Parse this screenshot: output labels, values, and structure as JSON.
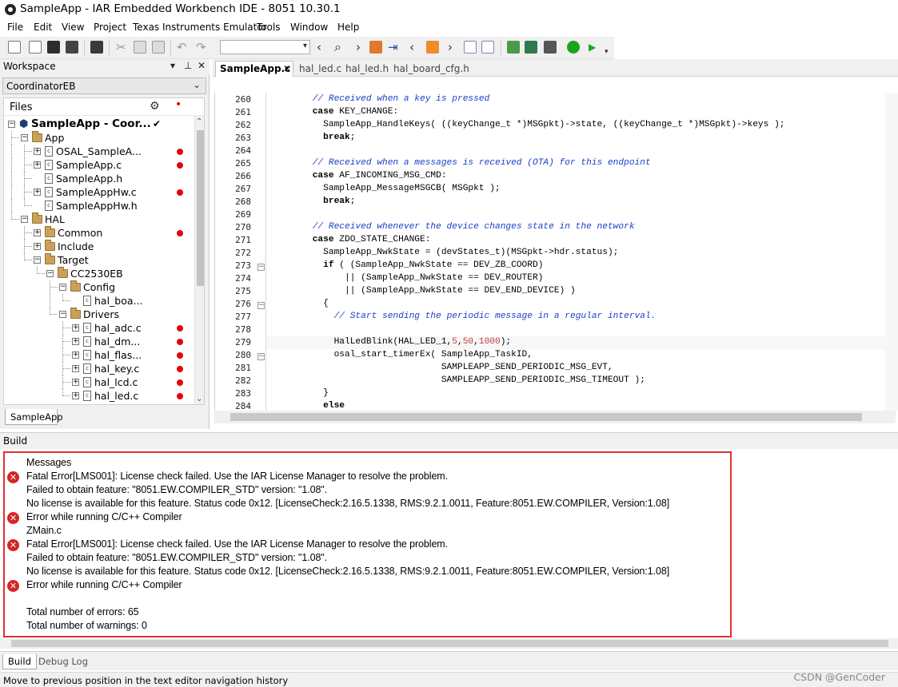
{
  "window": {
    "title": "SampleApp - IAR Embedded Workbench IDE - 8051 10.30.1"
  },
  "menu": [
    "File",
    "Edit",
    "View",
    "Project",
    "Texas Instruments Emulator",
    "Tools",
    "Window",
    "Help"
  ],
  "toolbar": {
    "combo_value": ""
  },
  "workspace": {
    "title": "Workspace",
    "config": "CoordinatorEB",
    "files_header": "Files",
    "tab": "SampleApp",
    "tree": [
      {
        "label": "SampleApp - Coor...",
        "level": 0,
        "kind": "project",
        "expand": "-",
        "checked": true,
        "error": false
      },
      {
        "label": "App",
        "level": 1,
        "kind": "folder",
        "expand": "-",
        "error": false
      },
      {
        "label": "OSAL_SampleA...",
        "level": 2,
        "kind": "file",
        "expand": "+",
        "error": true
      },
      {
        "label": "SampleApp.c",
        "level": 2,
        "kind": "file",
        "expand": "+",
        "error": true
      },
      {
        "label": "SampleApp.h",
        "level": 2,
        "kind": "file",
        "expand": "",
        "error": false
      },
      {
        "label": "SampleAppHw.c",
        "level": 2,
        "kind": "file",
        "expand": "+",
        "error": true
      },
      {
        "label": "SampleAppHw.h",
        "level": 2,
        "kind": "file",
        "expand": "",
        "error": false
      },
      {
        "label": "HAL",
        "level": 1,
        "kind": "folder",
        "expand": "-",
        "error": false
      },
      {
        "label": "Common",
        "level": 2,
        "kind": "folder",
        "expand": "+",
        "error": true
      },
      {
        "label": "Include",
        "level": 2,
        "kind": "folder",
        "expand": "+",
        "error": false
      },
      {
        "label": "Target",
        "level": 2,
        "kind": "folder",
        "expand": "-",
        "error": false
      },
      {
        "label": "CC2530EB",
        "level": 3,
        "kind": "folder",
        "expand": "-",
        "error": false
      },
      {
        "label": "Config",
        "level": 4,
        "kind": "folder",
        "expand": "-",
        "error": false
      },
      {
        "label": "hal_boa...",
        "level": 5,
        "kind": "file",
        "expand": "",
        "error": false
      },
      {
        "label": "Drivers",
        "level": 4,
        "kind": "folder",
        "expand": "-",
        "error": false
      },
      {
        "label": "hal_adc.c",
        "level": 5,
        "kind": "file",
        "expand": "+",
        "error": true
      },
      {
        "label": "hal_dm...",
        "level": 5,
        "kind": "file",
        "expand": "+",
        "error": true
      },
      {
        "label": "hal_flas...",
        "level": 5,
        "kind": "file",
        "expand": "+",
        "error": true
      },
      {
        "label": "hal_key.c",
        "level": 5,
        "kind": "file",
        "expand": "+",
        "error": true
      },
      {
        "label": "hal_lcd.c",
        "level": 5,
        "kind": "file",
        "expand": "+",
        "error": true
      },
      {
        "label": "hal_led.c",
        "level": 5,
        "kind": "file",
        "expand": "+",
        "error": true
      }
    ]
  },
  "editor": {
    "tabs": [
      "SampleApp.c",
      "hal_led.c",
      "hal_led.h",
      "hal_board_cfg.h"
    ],
    "active_tab": "SampleApp.c",
    "lines": [
      {
        "n": "260",
        "t": "        // Received when a key is pressed",
        "c": "cm"
      },
      {
        "n": "261",
        "t": "        case KEY_CHANGE:",
        "c": "case"
      },
      {
        "n": "262",
        "t": "          SampleApp_HandleKeys( ((keyChange_t *)MSGpkt)->state, ((keyChange_t *)MSGpkt)->keys );",
        "c": ""
      },
      {
        "n": "263",
        "t": "          break;",
        "c": "kw"
      },
      {
        "n": "264",
        "t": "",
        "c": ""
      },
      {
        "n": "265",
        "t": "        // Received when a messages is received (OTA) for this endpoint",
        "c": "cm"
      },
      {
        "n": "266",
        "t": "        case AF_INCOMING_MSG_CMD:",
        "c": "case"
      },
      {
        "n": "267",
        "t": "          SampleApp_MessageMSGCB( MSGpkt );",
        "c": ""
      },
      {
        "n": "268",
        "t": "          break;",
        "c": "kw"
      },
      {
        "n": "269",
        "t": "",
        "c": ""
      },
      {
        "n": "270",
        "t": "        // Received whenever the device changes state in the network",
        "c": "cm"
      },
      {
        "n": "271",
        "t": "        case ZDO_STATE_CHANGE:",
        "c": "case"
      },
      {
        "n": "272",
        "t": "          SampleApp_NwkState = (devStates_t)(MSGpkt->hdr.status);",
        "c": ""
      },
      {
        "n": "273",
        "t": "          if ( (SampleApp_NwkState == DEV_ZB_COORD)",
        "c": "if",
        "fold": true
      },
      {
        "n": "274",
        "t": "              || (SampleApp_NwkState == DEV_ROUTER)",
        "c": ""
      },
      {
        "n": "275",
        "t": "              || (SampleApp_NwkState == DEV_END_DEVICE) )",
        "c": ""
      },
      {
        "n": "276",
        "t": "          {",
        "c": "",
        "fold": true
      },
      {
        "n": "277",
        "t": "            // Start sending the periodic message in a regular interval.",
        "c": "cm"
      },
      {
        "n": "278",
        "t": "",
        "c": ""
      },
      {
        "n": "279",
        "t": "            HalLedBlink(HAL_LED_1,5,50,1000);",
        "c": "num"
      },
      {
        "n": "280",
        "t": "            osal_start_timerEx( SampleApp_TaskID,",
        "c": "",
        "fold": true
      },
      {
        "n": "281",
        "t": "                                SAMPLEAPP_SEND_PERIODIC_MSG_EVT,",
        "c": ""
      },
      {
        "n": "282",
        "t": "                                SAMPLEAPP_SEND_PERIODIC_MSG_TIMEOUT );",
        "c": ""
      },
      {
        "n": "283",
        "t": "          }",
        "c": ""
      },
      {
        "n": "284",
        "t": "          else",
        "c": "kw"
      }
    ]
  },
  "build": {
    "title": "Build",
    "header": "Messages",
    "messages": [
      {
        "text": "Fatal Error[LMS001]: License check failed. Use the IAR License Manager to resolve the problem.",
        "icon": "error"
      },
      {
        "text": "Failed to obtain feature: \"8051.EW.COMPILER_STD\" version: \"1.08\".",
        "icon": ""
      },
      {
        "text": "No license is available for this feature. Status code 0x12. [LicenseCheck:2.16.5.1338, RMS:9.2.1.0011, Feature:8051.EW.COMPILER, Version:1.08]",
        "icon": ""
      },
      {
        "text": "Error while running C/C++ Compiler",
        "icon": "error"
      },
      {
        "text": "ZMain.c",
        "icon": ""
      },
      {
        "text": "Fatal Error[LMS001]: License check failed. Use the IAR License Manager to resolve the problem.",
        "icon": "error"
      },
      {
        "text": "Failed to obtain feature: \"8051.EW.COMPILER_STD\" version: \"1.08\".",
        "icon": ""
      },
      {
        "text": "No license is available for this feature. Status code 0x12. [LicenseCheck:2.16.5.1338, RMS:9.2.1.0011, Feature:8051.EW.COMPILER, Version:1.08]",
        "icon": ""
      },
      {
        "text": "Error while running C/C++ Compiler",
        "icon": "error"
      },
      {
        "text": "",
        "icon": ""
      },
      {
        "text": "Total number of errors: 65",
        "icon": ""
      },
      {
        "text": "Total number of warnings: 0",
        "icon": ""
      }
    ],
    "tabs": [
      "Build",
      "Debug Log"
    ],
    "active_tab": "Build"
  },
  "status": {
    "text": "Move to previous position in the text editor navigation history",
    "watermark": "CSDN @GenCoder"
  },
  "colors": {
    "error_dot": "#e8000b",
    "comment": "#1e40c8",
    "highlight_box": "#e03030"
  }
}
